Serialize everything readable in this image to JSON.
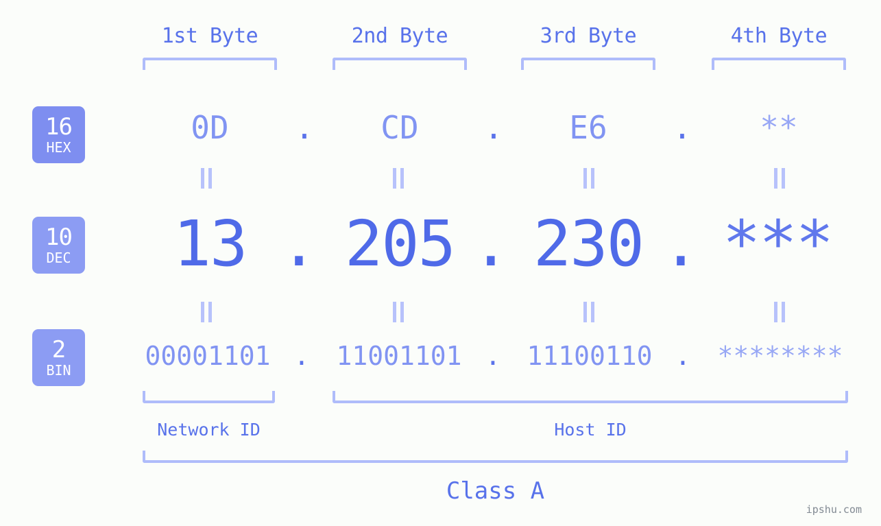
{
  "background_color": "#fbfdfa",
  "accent_color": "#5872ea",
  "bracket_color": "#afbcfa",
  "badge_color": "#7e8ef0",
  "byte_headers": [
    {
      "label": "1st Byte"
    },
    {
      "label": "2nd Byte"
    },
    {
      "label": "3rd Byte"
    },
    {
      "label": "4th Byte"
    }
  ],
  "rows": {
    "hex": {
      "badge_number": "16",
      "badge_radix": "HEX",
      "values": [
        "0D",
        "CD",
        "E6",
        "**"
      ],
      "separator": "."
    },
    "dec": {
      "badge_number": "10",
      "badge_radix": "DEC",
      "values": [
        "13",
        "205",
        "230",
        "***"
      ],
      "separator": "."
    },
    "bin": {
      "badge_number": "2",
      "badge_radix": "BIN",
      "values": [
        "00001101",
        "11001101",
        "11100110",
        "********"
      ],
      "separator": "."
    }
  },
  "equals_symbol": "=",
  "segments": {
    "network_id": "Network ID",
    "host_id": "Host ID",
    "class": "Class A"
  },
  "watermark": "ipshu.com"
}
